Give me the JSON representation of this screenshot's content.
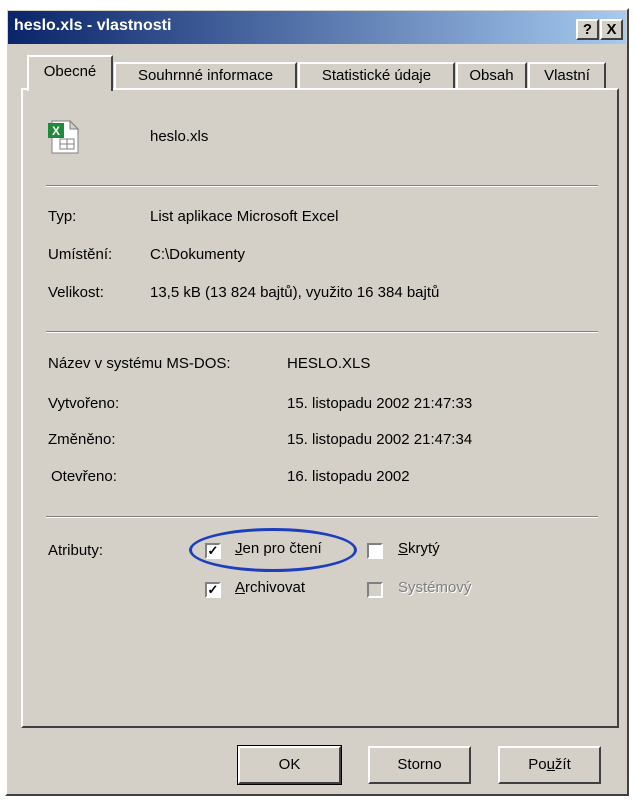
{
  "window": {
    "title": "heslo.xls - vlastnosti",
    "help_label": "?",
    "close_label": "X"
  },
  "tabs": [
    {
      "label": "Obecné",
      "active": true
    },
    {
      "label": "Souhrnné informace"
    },
    {
      "label": "Statistické údaje"
    },
    {
      "label": "Obsah"
    },
    {
      "label": "Vlastní"
    }
  ],
  "file": {
    "icon": "excel-file-icon",
    "name": "heslo.xls"
  },
  "details": {
    "type_label": "Typ:",
    "type_value": "List aplikace Microsoft Excel",
    "location_label": "Umístění:",
    "location_value": "C:\\Dokumenty",
    "size_label": "Velikost:",
    "size_value": "13,5 kB (13 824 bajtů), využito 16 384 bajtů"
  },
  "dates": {
    "msdos_label": "Název v systému MS-DOS:",
    "msdos_value": "HESLO.XLS",
    "created_label": "Vytvořeno:",
    "created_value": "15. listopadu 2002 21:47:33",
    "modified_label": "Změněno:",
    "modified_value": "15. listopadu 2002 21:47:34",
    "opened_label": "Otevřeno:",
    "opened_value": "16. listopadu 2002"
  },
  "attributes": {
    "label": "Atributy:",
    "readonly": {
      "label": "Jen pro čtení",
      "checked": true
    },
    "hidden": {
      "label": "Skrytý",
      "checked": false
    },
    "archive": {
      "label": "Archivovat",
      "checked": true
    },
    "system": {
      "label": "Systémový",
      "checked": false,
      "disabled": true
    }
  },
  "buttons": {
    "ok": "OK",
    "cancel": "Storno",
    "apply": "Použít"
  },
  "colors": {
    "titlebar_start": "#0a246a",
    "titlebar_end": "#a6caf0",
    "highlight_oval": "#1d3fbe"
  }
}
